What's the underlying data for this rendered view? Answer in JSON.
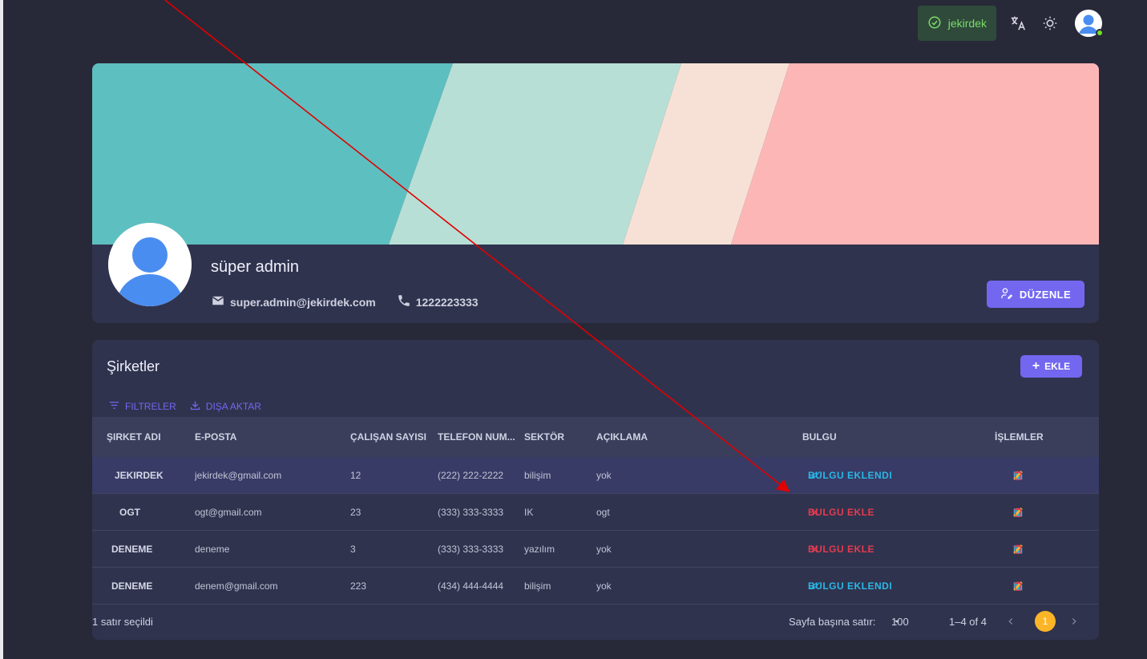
{
  "colors": {
    "background": "#272938",
    "card": "#30334e",
    "primary": "#7367f0",
    "success": "#72e128",
    "info": "#2ab7e6",
    "error": "#e33b4f",
    "warning": "#fdb528",
    "annotation_arrow": "#e00000"
  },
  "topbar": {
    "tenant_label": "jekirdek",
    "tenant_icon": "check-circle-icon",
    "translate_icon": "translate-icon",
    "theme_icon": "sun-icon",
    "avatar_icon": "user-avatar-icon"
  },
  "profile": {
    "name": "süper admin",
    "email": "super.admin@jekirdek.com",
    "phone": "1222223333",
    "edit_label": "DÜZENLE",
    "banner_colors": [
      "#5ebfc0",
      "#b8dfd6",
      "#f7e1d6",
      "#fdb6b6"
    ]
  },
  "companies": {
    "title": "Şirketler",
    "add_label": "EKLE",
    "filters_label": "FILTRELER",
    "export_label": "DIŞA AKTAR",
    "columns": {
      "name": "ŞIRKET ADI",
      "email": "E-POSTA",
      "employees": "ÇALIŞAN SAYISI",
      "phone": "TELEFON NUM...",
      "sector": "SEKTÖR",
      "description": "AÇIKLAMA",
      "finding": "BULGU",
      "actions": "İŞLEMLER"
    },
    "rows": [
      {
        "name": "JEKIRDEK",
        "email": "jekirdek@gmail.com",
        "employees": "12",
        "phone": "(222) 222-2222",
        "sector": "bilişim",
        "description": "yok",
        "finding": "BULGU EKLENDI",
        "finding_status": "added",
        "selected": true
      },
      {
        "name": "OGT",
        "email": "ogt@gmail.com",
        "employees": "23",
        "phone": "(333) 333-3333",
        "sector": "IK",
        "description": "ogt",
        "finding": "BULGU EKLE",
        "finding_status": "missing",
        "selected": false
      },
      {
        "name": "DENEME",
        "email": "deneme",
        "employees": "3",
        "phone": "(333) 333-3333",
        "sector": "yazılım",
        "description": "yok",
        "finding": "BULGU EKLE",
        "finding_status": "missing",
        "selected": false
      },
      {
        "name": "DENEME",
        "email": "denem@gmail.com",
        "employees": "223",
        "phone": "(434) 444-4444",
        "sector": "bilişim",
        "description": "yok",
        "finding": "BULGU EKLENDI",
        "finding_status": "added",
        "selected": false
      }
    ],
    "footer": {
      "selected_text": "1 satır seçildi",
      "rows_per_page_label": "Sayfa başına satır:",
      "rows_per_page_value": "100",
      "range_text": "1–4 of 4",
      "current_page": "1"
    }
  }
}
